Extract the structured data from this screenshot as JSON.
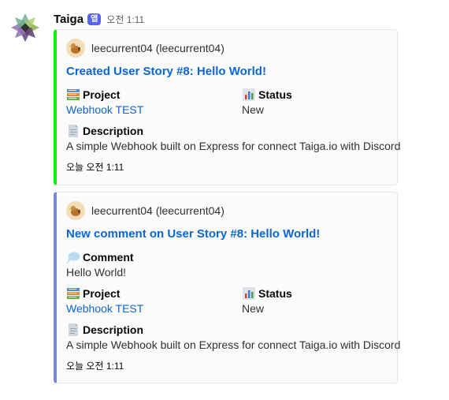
{
  "message": {
    "username": "Taiga",
    "badge": "앱",
    "time": "오전 1:11"
  },
  "embeds": [
    {
      "accent_color": "#14f000",
      "author": "leecurrent04 (leecurrent04)",
      "title": "Created User Story #8: Hello World!",
      "fields": {
        "project_label": "Project",
        "project_value": "Webhook TEST",
        "status_label": "Status",
        "status_value": "New",
        "description_label": "Description",
        "description_value": "A simple Webhook built on Express for connect Taiga.io with Discord"
      },
      "footer": "오늘 오전 1:11"
    },
    {
      "accent_color": "#7289da",
      "author": "leecurrent04 (leecurrent04)",
      "title": "New comment on User Story #8: Hello World!",
      "fields": {
        "comment_label": "Comment",
        "comment_value": "Hello World!",
        "project_label": "Project",
        "project_value": "Webhook TEST",
        "status_label": "Status",
        "status_value": "New",
        "description_label": "Description",
        "description_value": "A simple Webhook built on Express for connect Taiga.io with Discord"
      },
      "footer": "오늘 오전 1:11"
    }
  ],
  "icons": {
    "avatar": "taiga-logo-icon",
    "author": "chicken-avatar-icon",
    "project": "books-emoji-icon",
    "status": "bar-chart-emoji-icon",
    "description": "page-emoji-icon",
    "comment": "speech-balloon-emoji-icon"
  }
}
